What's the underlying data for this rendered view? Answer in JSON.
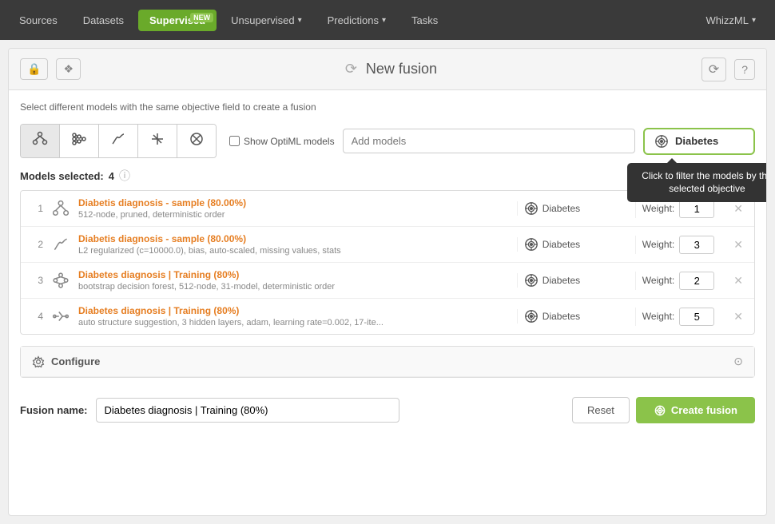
{
  "navbar": {
    "items": [
      {
        "id": "sources",
        "label": "Sources",
        "active": false
      },
      {
        "id": "datasets",
        "label": "Datasets",
        "active": false
      },
      {
        "id": "supervised",
        "label": "Supervised",
        "active": true,
        "badge": "NEW"
      },
      {
        "id": "unsupervised",
        "label": "Unsupervised",
        "active": false
      },
      {
        "id": "predictions",
        "label": "Predictions",
        "active": false
      },
      {
        "id": "tasks",
        "label": "Tasks",
        "active": false
      }
    ],
    "whizzml_label": "WhizzML"
  },
  "header": {
    "title": "New fusion",
    "subtitle": "Select different models with the same objective field to create a fusion"
  },
  "model_types": [
    {
      "id": "tree",
      "symbol": "🌲"
    },
    {
      "id": "network",
      "symbol": "🕸"
    },
    {
      "id": "linear",
      "symbol": "∫"
    },
    {
      "id": "split",
      "symbol": "⋈"
    },
    {
      "id": "anomaly",
      "symbol": "⊗"
    }
  ],
  "show_optiml": "Show OptiML models",
  "add_models_placeholder": "Add models",
  "objective": {
    "label": "Diabetes",
    "tooltip": "Click to filter the models by the selected objective"
  },
  "models_selected": {
    "label": "Models selected:",
    "count": "4"
  },
  "models": [
    {
      "num": "1",
      "type": "tree",
      "name": "Diabetis diagnosis - sample (80.00%)",
      "desc": "512-node, pruned, deterministic order",
      "objective": "Diabetes",
      "weight": "1"
    },
    {
      "num": "2",
      "type": "linear",
      "name": "Diabetis diagnosis - sample (80.00%)",
      "desc": "L2 regularized (c=10000.0), bias, auto-scaled, missing values, stats",
      "objective": "Diabetes",
      "weight": "3"
    },
    {
      "num": "3",
      "type": "forest",
      "name": "Diabetes diagnosis | Training (80%)",
      "desc": "bootstrap decision forest, 512-node, 31-model, deterministic order",
      "objective": "Diabetes",
      "weight": "2"
    },
    {
      "num": "4",
      "type": "network2",
      "name": "Diabetes diagnosis | Training (80%)",
      "desc": "auto structure suggestion, 3 hidden layers, adam, learning rate=0.002, 17-ite...",
      "objective": "Diabetes",
      "weight": "5"
    }
  ],
  "configure": {
    "label": "Configure"
  },
  "footer": {
    "fusion_name_label": "Fusion name:",
    "fusion_name_value": "Diabetes diagnosis | Training (80%)",
    "reset_label": "Reset",
    "create_label": "Create fusion"
  }
}
